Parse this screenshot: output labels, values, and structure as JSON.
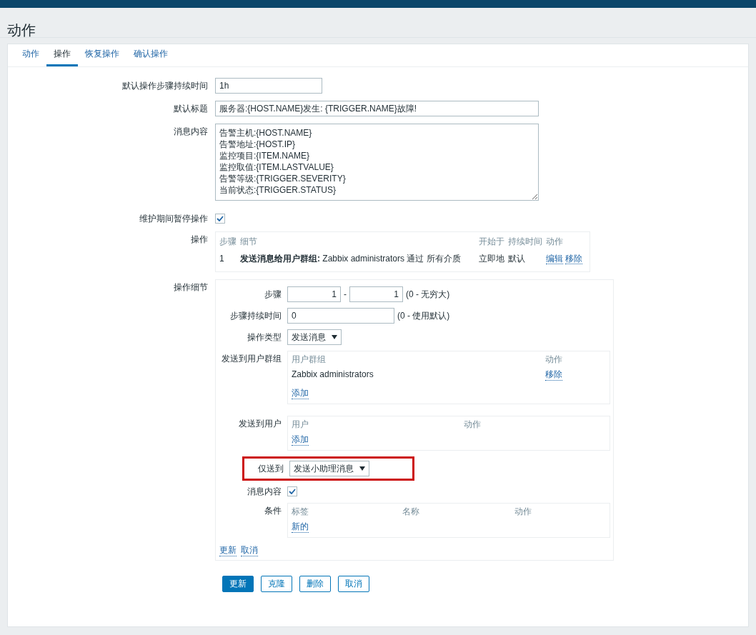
{
  "page_title": "动作",
  "tabs": [
    {
      "label": "动作",
      "selected": false
    },
    {
      "label": "操作",
      "selected": true
    },
    {
      "label": "恢复操作",
      "selected": false
    },
    {
      "label": "确认操作",
      "selected": false
    }
  ],
  "form": {
    "default_step_duration": {
      "label": "默认操作步骤持续时间",
      "value": "1h"
    },
    "default_subject": {
      "label": "默认标题",
      "value": "服务器:{HOST.NAME}发生: {TRIGGER.NAME}故障!"
    },
    "default_message": {
      "label": "消息内容",
      "lines": [
        "告警主机:{HOST.NAME}",
        "告警地址:{HOST.IP}",
        "监控项目:{ITEM.NAME}",
        "监控取值:{ITEM.LASTVALUE}",
        "告警等级:{TRIGGER.SEVERITY}",
        "当前状态:{TRIGGER.STATUS}"
      ]
    },
    "pause_in_maintenance": {
      "label": "维护期间暂停操作",
      "checked": true
    },
    "operations": {
      "label": "操作",
      "columns": [
        "步骤",
        "细节",
        "开始于",
        "持续时间",
        "动作"
      ],
      "rows": [
        {
          "step": "1",
          "details": "**发送消息给用户群组:** Zabbix administrators 通过 所有介质",
          "start_in": "立即地",
          "duration": "默认",
          "actions": [
            "编辑",
            "移除"
          ]
        }
      ]
    },
    "operation_details": {
      "label": "操作细节",
      "steps": {
        "label": "步骤",
        "from": "1",
        "to": "1",
        "separator": "-",
        "hint": "(0 - 无穷大)"
      },
      "step_duration": {
        "label": "步骤持续时间",
        "value": "0",
        "hint": "(0 - 使用默认)"
      },
      "operation_type": {
        "label": "操作类型",
        "value": "发送消息"
      },
      "user_groups": {
        "label": "发送到用户群组",
        "columns": [
          "用户群组",
          "动作"
        ],
        "rows": [
          {
            "name": "Zabbix administrators",
            "action": "移除"
          }
        ],
        "add": "添加"
      },
      "users": {
        "label": "发送到用户",
        "columns": [
          "用户",
          "动作"
        ],
        "add": "添加"
      },
      "send_only_to": {
        "label": "仅送到",
        "value": "发送小助理消息",
        "highlighted": true
      },
      "default_message": {
        "label": "消息内容",
        "checked": true
      },
      "conditions": {
        "label": "条件",
        "columns": [
          "标签",
          "名称",
          "动作"
        ],
        "add": "新的"
      },
      "links": [
        "更新",
        "取消"
      ]
    }
  },
  "buttons": [
    {
      "label": "更新",
      "primary": true
    },
    {
      "label": "克隆",
      "primary": false
    },
    {
      "label": "删除",
      "primary": false
    },
    {
      "label": "取消",
      "primary": false
    }
  ]
}
